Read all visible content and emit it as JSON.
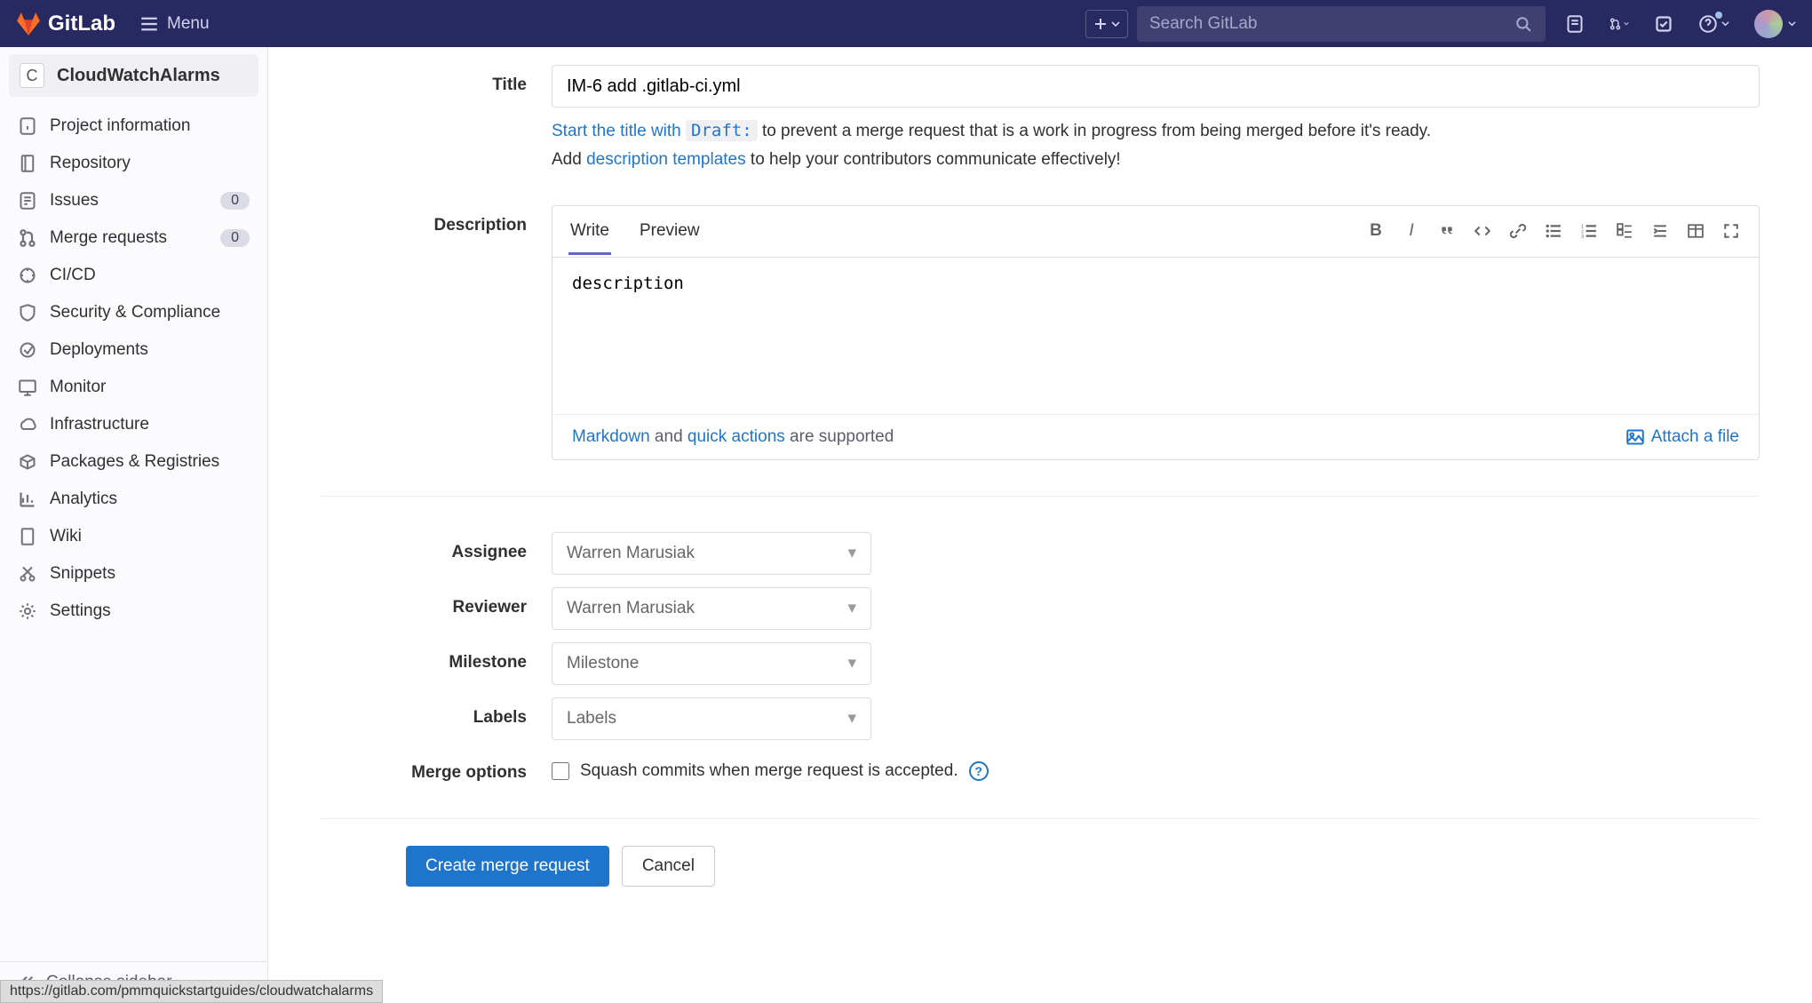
{
  "header": {
    "brand": "GitLab",
    "menu_label": "Menu",
    "search_placeholder": "Search GitLab"
  },
  "sidebar": {
    "project_initial": "C",
    "project_name": "CloudWatchAlarms",
    "items": [
      {
        "icon": "info-icon",
        "label": "Project information"
      },
      {
        "icon": "repo-icon",
        "label": "Repository"
      },
      {
        "icon": "issues-icon",
        "label": "Issues",
        "badge": "0"
      },
      {
        "icon": "merge-icon",
        "label": "Merge requests",
        "badge": "0"
      },
      {
        "icon": "cicd-icon",
        "label": "CI/CD"
      },
      {
        "icon": "shield-icon",
        "label": "Security & Compliance"
      },
      {
        "icon": "deploy-icon",
        "label": "Deployments"
      },
      {
        "icon": "monitor-icon",
        "label": "Monitor"
      },
      {
        "icon": "infra-icon",
        "label": "Infrastructure"
      },
      {
        "icon": "package-icon",
        "label": "Packages & Registries"
      },
      {
        "icon": "analytics-icon",
        "label": "Analytics"
      },
      {
        "icon": "wiki-icon",
        "label": "Wiki"
      },
      {
        "icon": "snippets-icon",
        "label": "Snippets"
      },
      {
        "icon": "settings-icon",
        "label": "Settings"
      }
    ],
    "collapse_label": "Collapse sidebar"
  },
  "form": {
    "title_label": "Title",
    "title_value": "IM-6 add .gitlab-ci.yml",
    "hint1_a": "Start the title with ",
    "hint1_code": "Draft:",
    "hint1_b": " to prevent a merge request that is a work in progress from being merged before it's ready.",
    "hint2_a": "Add ",
    "hint2_link": "description templates",
    "hint2_b": " to help your contributors communicate effectively!",
    "desc_label": "Description",
    "tabs": {
      "write": "Write",
      "preview": "Preview"
    },
    "desc_value": "description",
    "md_link": "Markdown",
    "md_and": " and ",
    "qa_link": "quick actions",
    "md_supported": " are supported",
    "attach_label": "Attach a file",
    "assignee_label": "Assignee",
    "assignee_value": "Warren Marusiak",
    "reviewer_label": "Reviewer",
    "reviewer_value": "Warren Marusiak",
    "milestone_label": "Milestone",
    "milestone_value": "Milestone",
    "labels_label": "Labels",
    "labels_value": "Labels",
    "merge_options_label": "Merge options",
    "squash_label": "Squash commits when merge request is accepted.",
    "submit_label": "Create merge request",
    "cancel_label": "Cancel"
  },
  "status_url": "https://gitlab.com/pmmquickstartguides/cloudwatchalarms"
}
